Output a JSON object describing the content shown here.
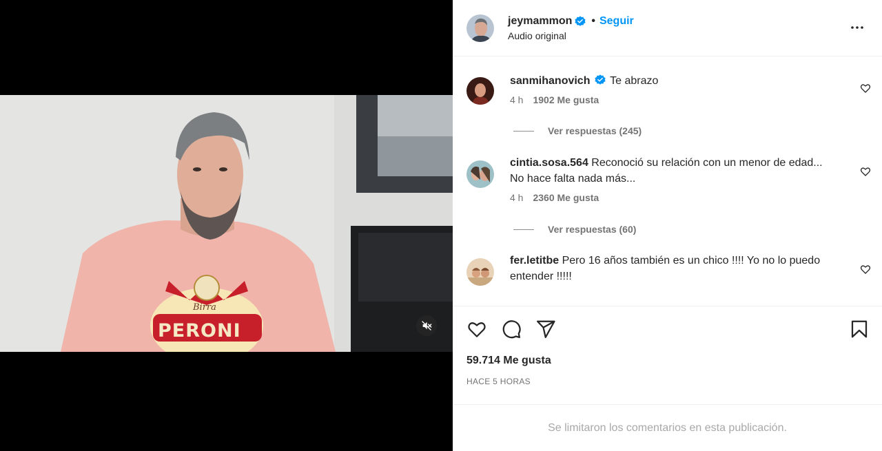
{
  "header": {
    "username": "jeymammon",
    "separator": "•",
    "follow_label": "Seguir",
    "subtitle": "Audio original"
  },
  "comments": [
    {
      "username": "sanmihanovich",
      "verified": true,
      "text": "Te abrazo",
      "text_line2": "",
      "time": "4 h",
      "likes": "1902 Me gusta",
      "replies": "Ver respuestas (245)"
    },
    {
      "username": "cintia.sosa.564",
      "verified": false,
      "text": "Reconoció su relación con un menor de edad...",
      "text_line2": "No hace falta nada más...",
      "time": "4 h",
      "likes": "2360 Me gusta",
      "replies": "Ver respuestas (60)"
    },
    {
      "username": "fer.letitbe",
      "verified": false,
      "text": "Pero 16 años también es un chico !!!! Yo no lo puedo",
      "text_line2": "entender !!!!!",
      "time": "",
      "likes": "",
      "replies": ""
    }
  ],
  "post": {
    "likes_count": "59.714 Me gusta",
    "timestamp": "HACE 5 HORAS",
    "comments_limited": "Se limitaron los comentarios en esta publicación."
  },
  "video": {
    "shirt_brand": "PERONI",
    "shirt_script": "Birra"
  },
  "icons": {
    "more": "more-options-icon",
    "like": "heart-icon",
    "comment": "comment-icon",
    "share": "share-icon",
    "save": "bookmark-icon",
    "mute": "muted-icon",
    "verified": "verified-badge-icon"
  },
  "colors": {
    "accent": "#0095f6",
    "text": "#262626",
    "muted": "#737373",
    "shirt_pink": "#f1b6ad",
    "peroni_red": "#c8202a"
  }
}
